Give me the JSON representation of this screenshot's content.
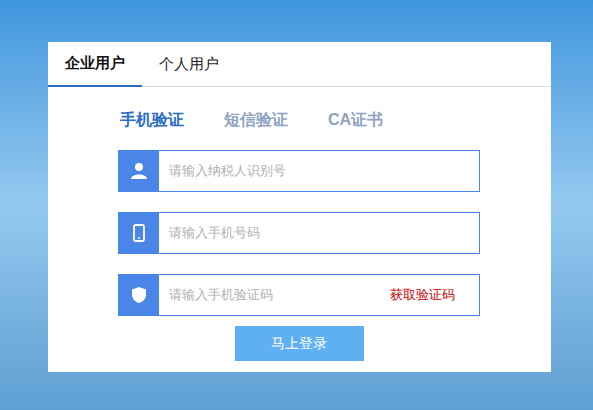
{
  "tabs": [
    {
      "label": "企业用户",
      "selected": true
    },
    {
      "label": "个人用户",
      "selected": false
    }
  ],
  "methods": [
    {
      "label": "手机验证",
      "selected": true
    },
    {
      "label": "短信验证",
      "selected": false
    },
    {
      "label": "CA证书",
      "selected": false
    }
  ],
  "fields": [
    {
      "placeholder": "请输入纳税人识别号",
      "kind": "user",
      "action": ""
    },
    {
      "placeholder": "请输入手机号码",
      "kind": "phone",
      "action": ""
    },
    {
      "placeholder": "请输入手机验证码",
      "kind": "code",
      "action": "获取验证码"
    }
  ],
  "submit": "马上登录"
}
